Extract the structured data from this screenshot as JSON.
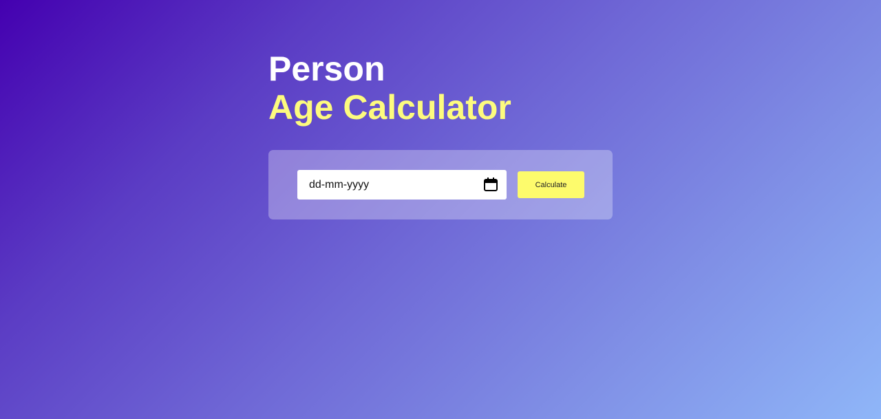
{
  "header": {
    "title_line1": "Person",
    "title_line2": "Age Calculator"
  },
  "form": {
    "date_placeholder": "dd-mm-yyyy",
    "calendar_icon": "calendar-icon",
    "button_label": "Calculate"
  },
  "colors": {
    "accent_yellow": "#fdfb7e",
    "button_yellow": "#fdfb6c",
    "gradient_start": "#4400b0",
    "gradient_end": "#8fb6f8"
  }
}
